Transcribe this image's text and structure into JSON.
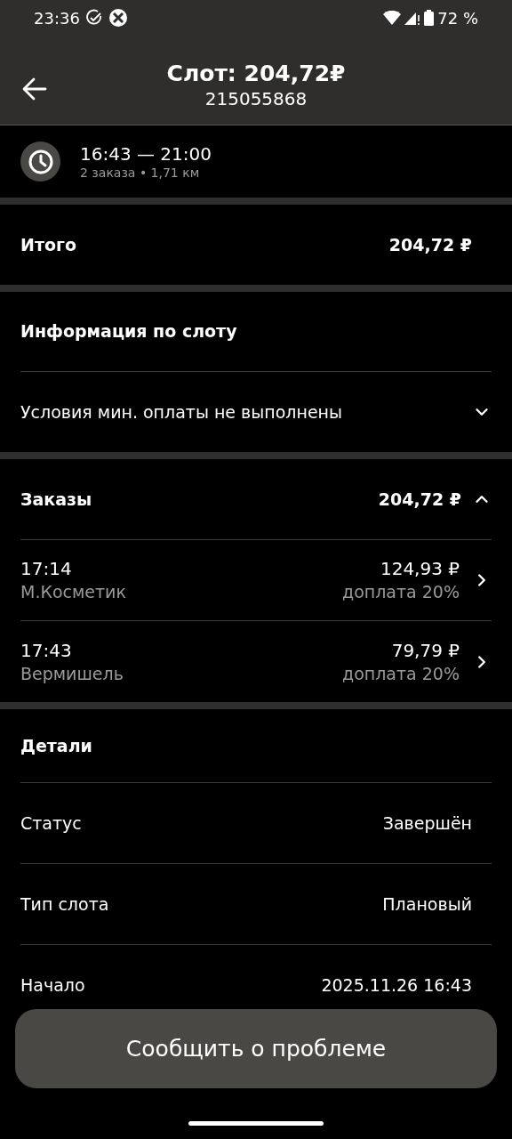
{
  "status_bar": {
    "time": "23:36",
    "battery": "72 %"
  },
  "header": {
    "title": "Слот: 204,72₽",
    "subtitle": "215055868"
  },
  "slot_time": {
    "range": "16:43 — 21:00",
    "meta": "2 заказа • 1,71 км"
  },
  "total": {
    "label": "Итого",
    "value": "204,72 ₽"
  },
  "slot_info": {
    "title": "Информация по слоту",
    "condition": "Условия мин. оплаты не выполнены",
    "expanded": false
  },
  "orders": {
    "title": "Заказы",
    "total": "204,72 ₽",
    "expanded": true,
    "items": [
      {
        "time": "17:14",
        "name": "М.Косметик",
        "amount": "124,93 ₽",
        "note": "доплата 20%"
      },
      {
        "time": "17:43",
        "name": "Вермишель",
        "amount": "79,79 ₽",
        "note": "доплата 20%"
      }
    ]
  },
  "details": {
    "title": "Детали",
    "rows": [
      {
        "label": "Статус",
        "value": "Завершён"
      },
      {
        "label": "Тип слота",
        "value": "Плановый"
      },
      {
        "label": "Начало",
        "value": "2025.11.26 16:43"
      }
    ]
  },
  "report_button": "Сообщить о проблеме"
}
